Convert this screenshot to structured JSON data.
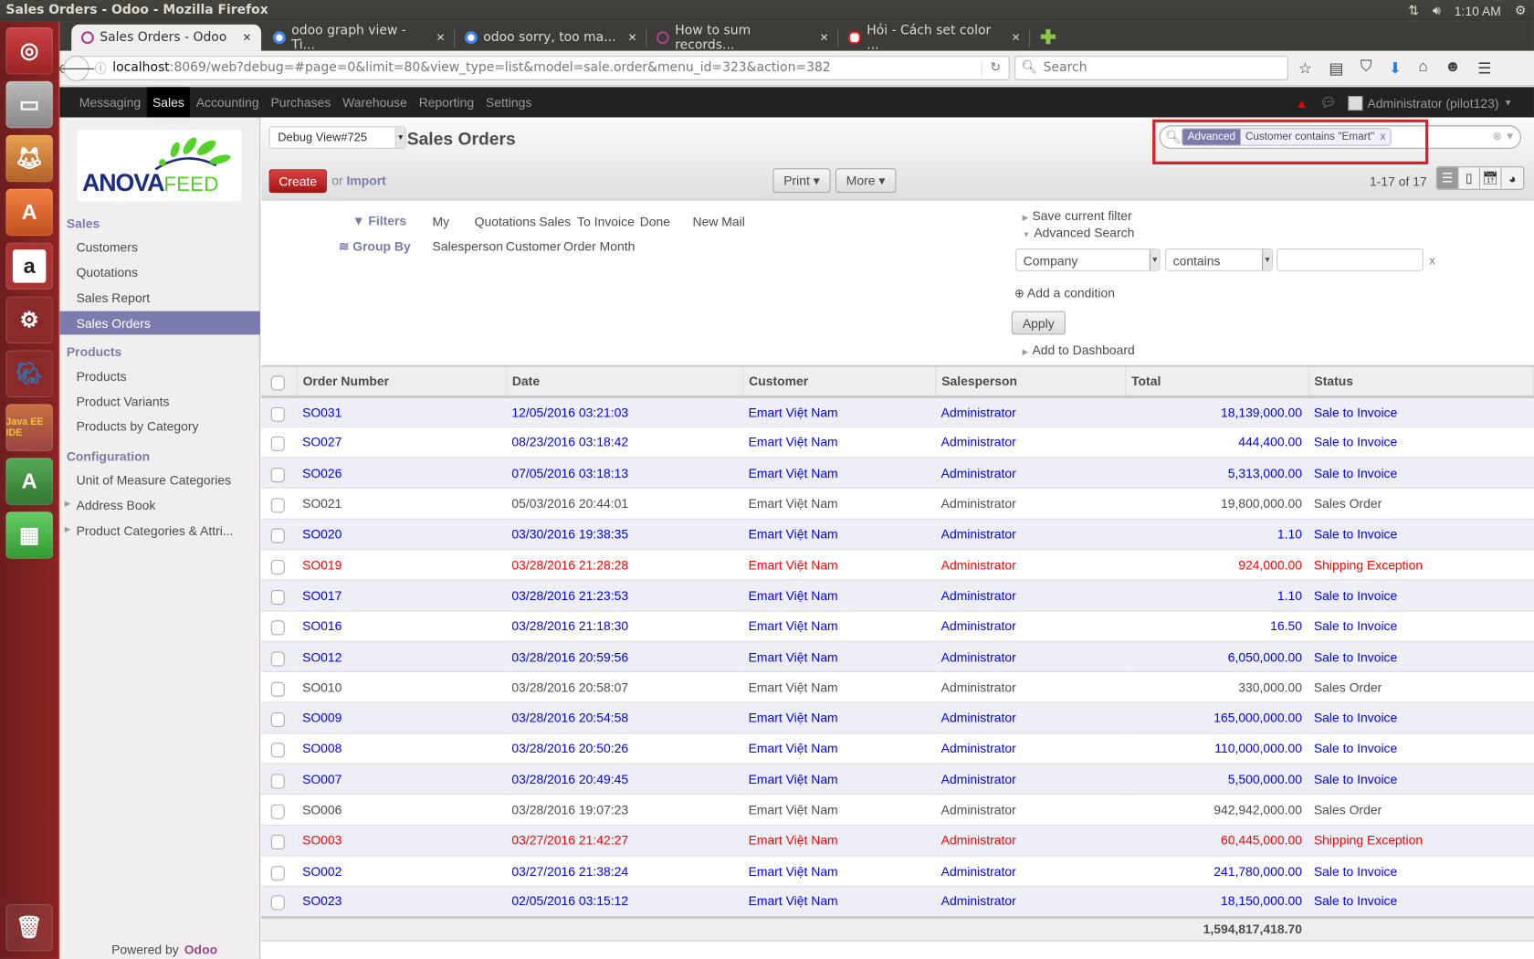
{
  "os": {
    "window_title": "Sales Orders - Odoo - Mozilla Firefox",
    "clock": "1:10 AM"
  },
  "browser": {
    "tabs": [
      {
        "label": "Sales Orders - Odoo",
        "favicon": "odoo",
        "active": true
      },
      {
        "label": "odoo graph view - Tì...",
        "favicon": "google",
        "active": false
      },
      {
        "label": "odoo sorry, too ma...",
        "favicon": "google",
        "active": false
      },
      {
        "label": "How to sum records...",
        "favicon": "odoo",
        "active": false
      },
      {
        "label": "Hỏi - Cách set color ...",
        "favicon": "opera",
        "active": false
      }
    ],
    "url_host": "localhost",
    "url_rest": ":8069/web?debug=#page=0&limit=80&view_type=list&model=sale.order&menu_id=323&action=382",
    "search_placeholder": "Search"
  },
  "topmenu": {
    "items": [
      "Messaging",
      "Sales",
      "Accounting",
      "Purchases",
      "Warehouse",
      "Reporting",
      "Settings"
    ],
    "active": "Sales",
    "user": "Administrator (pilot123)"
  },
  "sidebar": {
    "logo": {
      "main": "ANOVA",
      "sub": "FEED"
    },
    "sections": [
      {
        "title": "Sales",
        "items": [
          {
            "label": "Customers"
          },
          {
            "label": "Quotations"
          },
          {
            "label": "Sales Report"
          },
          {
            "label": "Sales Orders",
            "active": true
          }
        ]
      },
      {
        "title": "Products",
        "items": [
          {
            "label": "Products"
          },
          {
            "label": "Product Variants"
          },
          {
            "label": "Products by Category"
          }
        ]
      },
      {
        "title": "Configuration",
        "items": [
          {
            "label": "Unit of Measure Categories"
          },
          {
            "label": "Address Book",
            "expandable": true
          },
          {
            "label": "Product Categories & Attri...",
            "expandable": true
          }
        ]
      }
    ],
    "powered_by": "Powered by",
    "powered_brand": "Odoo"
  },
  "controlpanel": {
    "debug_view": "Debug View#725",
    "title": "Sales Orders",
    "facet_category": "Advanced",
    "facet_value": "Customer contains \"Emart\"",
    "facet_remove": "x",
    "create_label": "Create",
    "or_label": "or",
    "import_label": "Import",
    "print_label": "Print ▾",
    "more_label": "More ▾",
    "pager": "1-17 of 17"
  },
  "drawer": {
    "filters_label": "Filters",
    "filters": [
      "My",
      "Quotations",
      "Sales",
      "To Invoice",
      "Done",
      "New Mail"
    ],
    "groupby_label": "Group By",
    "groupby": [
      "Salesperson",
      "Customer",
      "Order Month"
    ],
    "save_filter": "Save current filter",
    "advanced_search": "Advanced Search",
    "condition_field": "Company",
    "condition_operator": "contains",
    "condition_value": "",
    "condition_remove": "x",
    "add_condition": "Add a condition",
    "apply_label": "Apply",
    "add_dashboard": "Add to Dashboard"
  },
  "table": {
    "columns": [
      "Order Number",
      "Date",
      "Customer",
      "Salesperson",
      "Total",
      "Status"
    ],
    "rows": [
      {
        "number": "SO031",
        "date": "12/05/2016 03:21:03",
        "customer": "Emart Việt Nam",
        "salesperson": "Administrator",
        "total": "18,139,000.00",
        "status": "Sale to Invoice",
        "kind": "invoice"
      },
      {
        "number": "SO027",
        "date": "08/23/2016 03:18:42",
        "customer": "Emart Việt Nam",
        "salesperson": "Administrator",
        "total": "444,400.00",
        "status": "Sale to Invoice",
        "kind": "invoice"
      },
      {
        "number": "SO026",
        "date": "07/05/2016 03:18:13",
        "customer": "Emart Việt Nam",
        "salesperson": "Administrator",
        "total": "5,313,000.00",
        "status": "Sale to Invoice",
        "kind": "invoice"
      },
      {
        "number": "SO021",
        "date": "05/03/2016 20:44:01",
        "customer": "Emart Việt Nam",
        "salesperson": "Administrator",
        "total": "19,800,000.00",
        "status": "Sales Order",
        "kind": "order"
      },
      {
        "number": "SO020",
        "date": "03/30/2016 19:38:35",
        "customer": "Emart Việt Nam",
        "salesperson": "Administrator",
        "total": "1.10",
        "status": "Sale to Invoice",
        "kind": "invoice"
      },
      {
        "number": "SO019",
        "date": "03/28/2016 21:28:28",
        "customer": "Emart Việt Nam",
        "salesperson": "Administrator",
        "total": "924,000.00",
        "status": "Shipping Exception",
        "kind": "exception"
      },
      {
        "number": "SO017",
        "date": "03/28/2016 21:23:53",
        "customer": "Emart Việt Nam",
        "salesperson": "Administrator",
        "total": "1.10",
        "status": "Sale to Invoice",
        "kind": "invoice"
      },
      {
        "number": "SO016",
        "date": "03/28/2016 21:18:30",
        "customer": "Emart Việt Nam",
        "salesperson": "Administrator",
        "total": "16.50",
        "status": "Sale to Invoice",
        "kind": "invoice"
      },
      {
        "number": "SO012",
        "date": "03/28/2016 20:59:56",
        "customer": "Emart Việt Nam",
        "salesperson": "Administrator",
        "total": "6,050,000.00",
        "status": "Sale to Invoice",
        "kind": "invoice"
      },
      {
        "number": "SO010",
        "date": "03/28/2016 20:58:07",
        "customer": "Emart Việt Nam",
        "salesperson": "Administrator",
        "total": "330,000.00",
        "status": "Sales Order",
        "kind": "order"
      },
      {
        "number": "SO009",
        "date": "03/28/2016 20:54:58",
        "customer": "Emart Việt Nam",
        "salesperson": "Administrator",
        "total": "165,000,000.00",
        "status": "Sale to Invoice",
        "kind": "invoice"
      },
      {
        "number": "SO008",
        "date": "03/28/2016 20:50:26",
        "customer": "Emart Việt Nam",
        "salesperson": "Administrator",
        "total": "110,000,000.00",
        "status": "Sale to Invoice",
        "kind": "invoice"
      },
      {
        "number": "SO007",
        "date": "03/28/2016 20:49:45",
        "customer": "Emart Việt Nam",
        "salesperson": "Administrator",
        "total": "5,500,000.00",
        "status": "Sale to Invoice",
        "kind": "invoice"
      },
      {
        "number": "SO006",
        "date": "03/28/2016 19:07:23",
        "customer": "Emart Việt Nam",
        "salesperson": "Administrator",
        "total": "942,942,000.00",
        "status": "Sales Order",
        "kind": "order"
      },
      {
        "number": "SO003",
        "date": "03/27/2016 21:42:27",
        "customer": "Emart Việt Nam",
        "salesperson": "Administrator",
        "total": "60,445,000.00",
        "status": "Shipping Exception",
        "kind": "exception"
      },
      {
        "number": "SO002",
        "date": "03/27/2016 21:38:24",
        "customer": "Emart Việt Nam",
        "salesperson": "Administrator",
        "total": "241,780,000.00",
        "status": "Sale to Invoice",
        "kind": "invoice"
      },
      {
        "number": "SO023",
        "date": "02/05/2016 03:15:12",
        "customer": "Emart Việt Nam",
        "salesperson": "Administrator",
        "total": "18,150,000.00",
        "status": "Sale to Invoice",
        "kind": "invoice"
      }
    ],
    "sum_total": "1,594,817,418.70"
  },
  "colors": {
    "odoo_purple": "#7c7bad",
    "invoice_blue": "#0000ff",
    "exception_red": "#ff0000",
    "highlight_red": "#e31c24"
  }
}
